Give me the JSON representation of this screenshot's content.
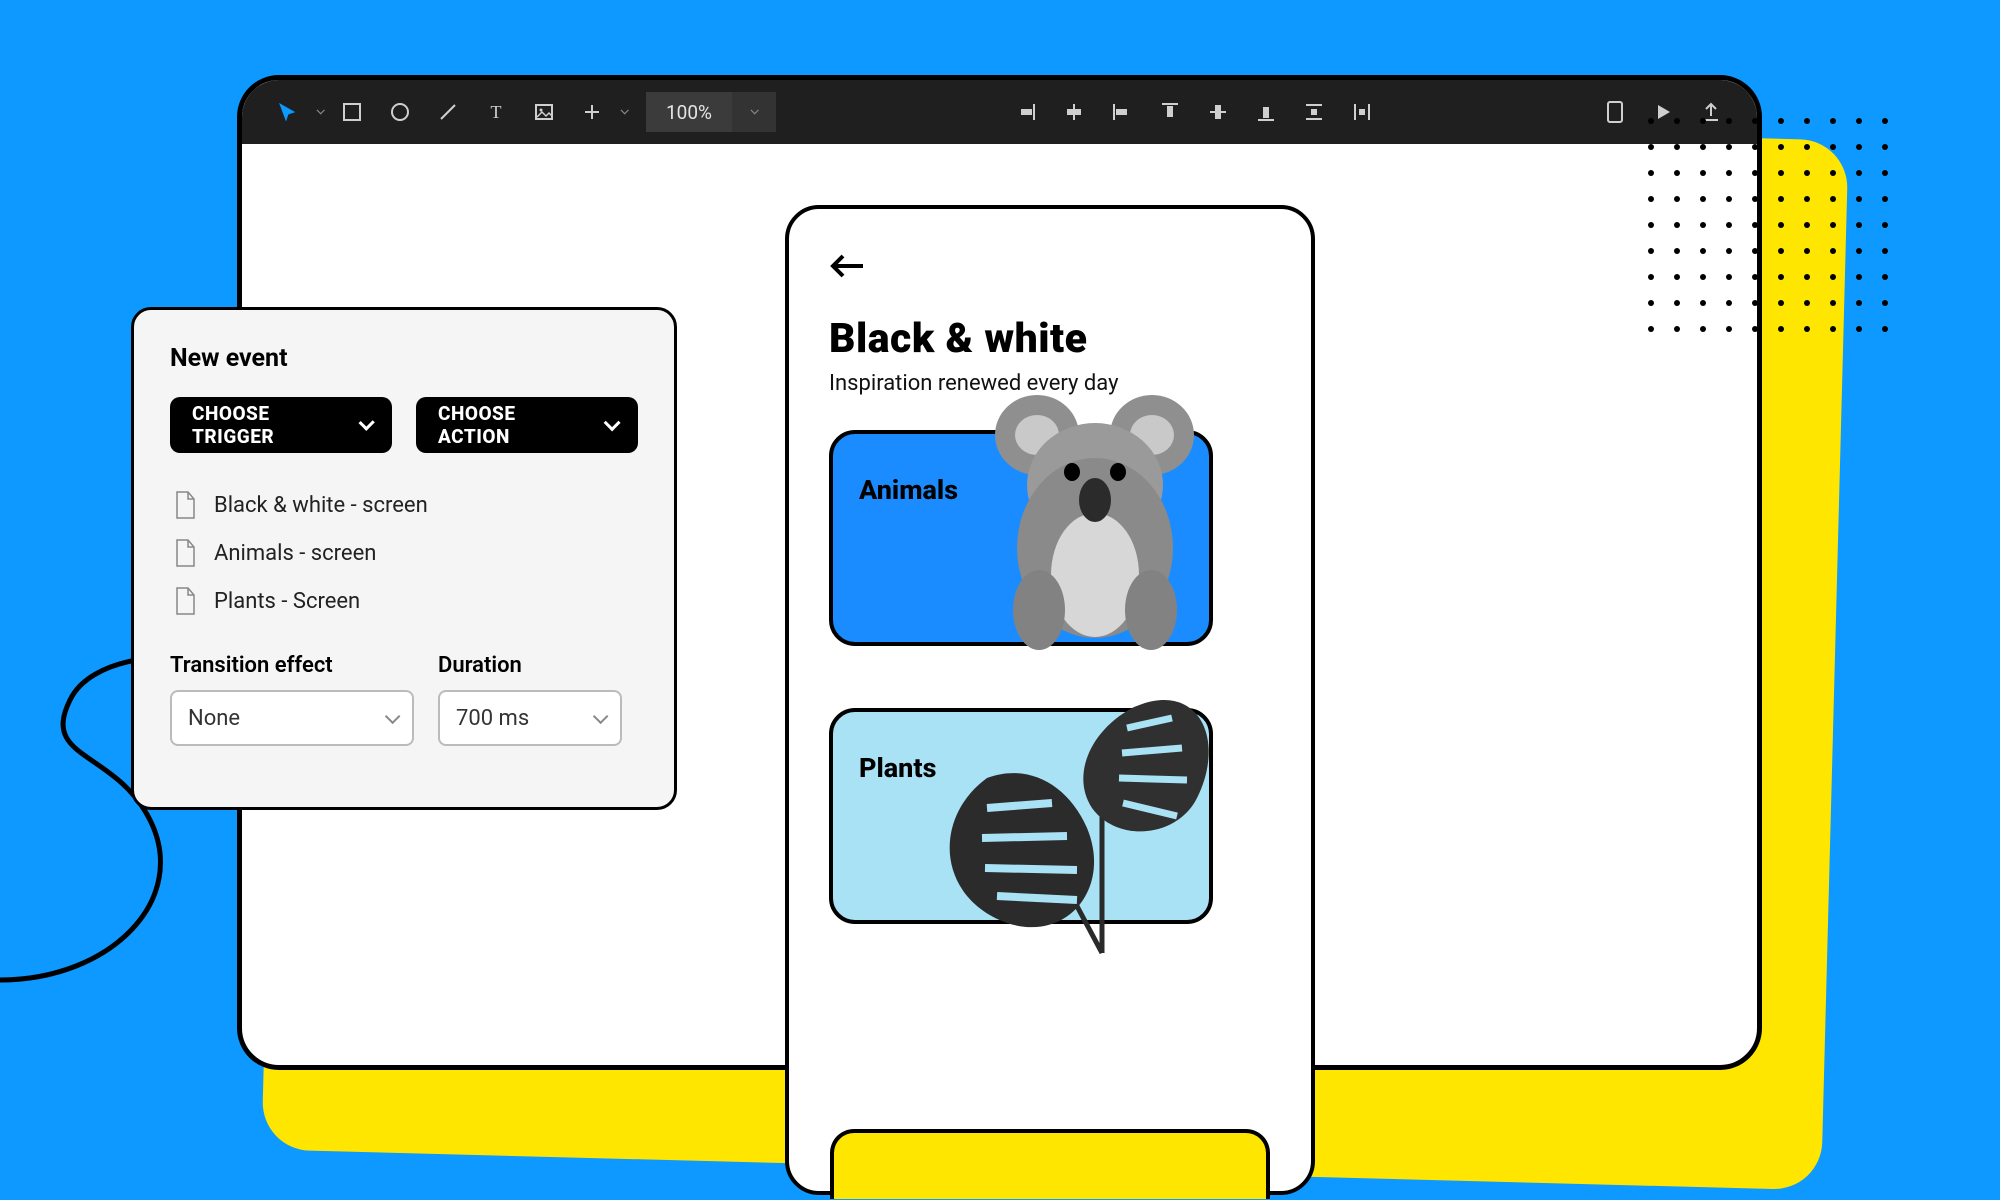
{
  "toolbar": {
    "zoom": "100%"
  },
  "panel": {
    "title": "New event",
    "trigger_btn": "CHOOSE TRIGGER",
    "action_btn": "CHOOSE ACTION",
    "screens": [
      {
        "label": "Black & white - screen"
      },
      {
        "label": "Animals - screen"
      },
      {
        "label": "Plants - Screen"
      }
    ],
    "transition_label": "Transition effect",
    "transition_value": "None",
    "duration_label": "Duration",
    "duration_value": "700 ms"
  },
  "phone": {
    "title": "Black & white",
    "subtitle": "Inspiration renewed every day",
    "cards": {
      "animals": "Animals",
      "plants": "Plants"
    }
  },
  "colors": {
    "bg": "#0d99ff",
    "accent": "#ffe600"
  }
}
